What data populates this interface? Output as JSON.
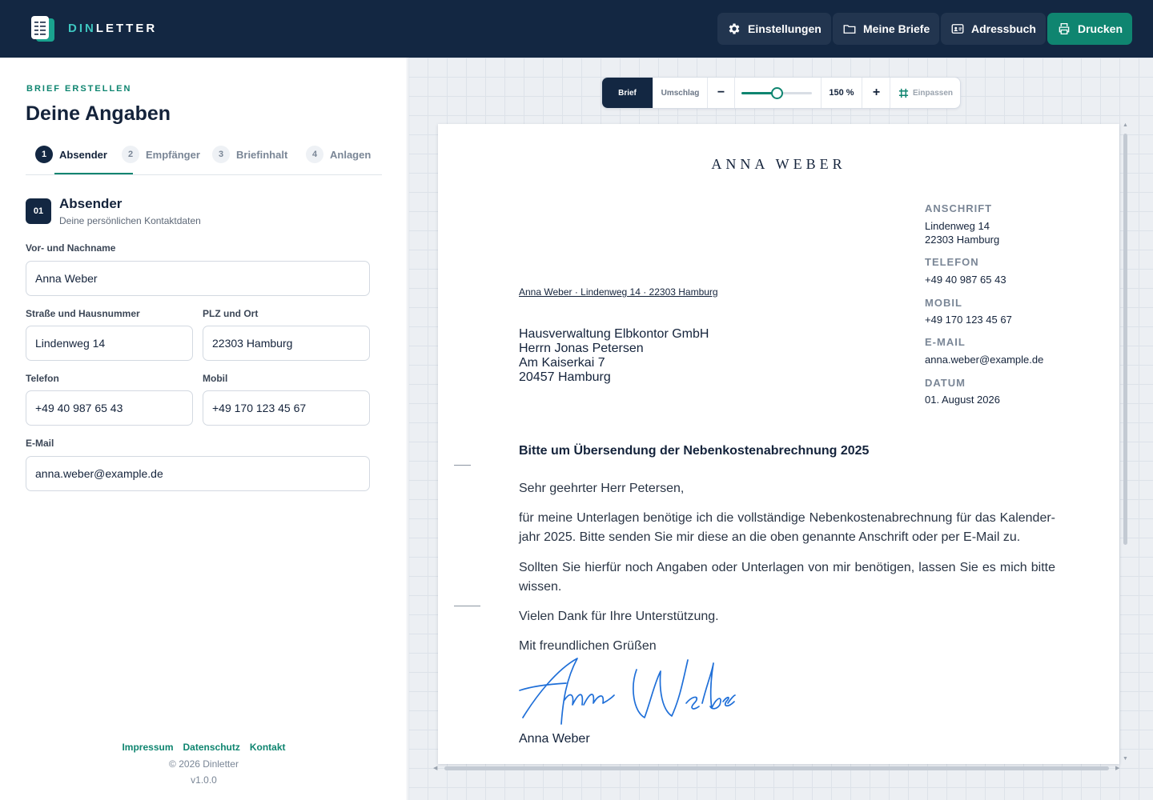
{
  "header": {
    "brand_part1": "DIN",
    "brand_part2": "LETTER",
    "nav": {
      "settings": "Einstellungen",
      "letters": "Meine Briefe",
      "addressbook": "Adressbuch",
      "print": "Drucken"
    }
  },
  "form": {
    "eyebrow": "BRIEF ERSTELLEN",
    "title": "Deine Angaben",
    "steps": [
      {
        "num": "1",
        "label": "Absender"
      },
      {
        "num": "2",
        "label": "Empfänger"
      },
      {
        "num": "3",
        "label": "Briefinhalt"
      },
      {
        "num": "4",
        "label": "Anlagen"
      }
    ],
    "section": {
      "badge": "01",
      "title": "Absender",
      "subtitle": "Deine persönlichen Kontaktdaten"
    },
    "fields": {
      "name": {
        "label": "Vor- und Nachname",
        "value": "Anna Weber"
      },
      "street": {
        "label": "Straße und Hausnummer",
        "value": "Lindenweg 14"
      },
      "city": {
        "label": "PLZ und Ort",
        "value": "22303 Hamburg"
      },
      "phone": {
        "label": "Telefon",
        "value": "+49 40 987 65 43"
      },
      "mobile": {
        "label": "Mobil",
        "value": "+49 170 123 45 67"
      },
      "email": {
        "label": "E-Mail",
        "value": "anna.weber@example.de"
      }
    }
  },
  "footer": {
    "links": [
      "Impressum",
      "Datenschutz",
      "Kontakt"
    ],
    "copyright": "© 2026 Dinletter",
    "version": "v1.0.0"
  },
  "toolbar": {
    "tab_letter": "Brief",
    "tab_envelope": "Umschlag",
    "zoom_label": "150 %",
    "zoom_fraction": 0.5,
    "fit_label": "Einpassen"
  },
  "letter": {
    "letterhead": "ANNA WEBER",
    "info": [
      {
        "label": "ANSCHRIFT",
        "lines": [
          "Lindenweg 14",
          "22303 Hamburg"
        ]
      },
      {
        "label": "TELEFON",
        "lines": [
          "+49 40 987 65 43"
        ]
      },
      {
        "label": "MOBIL",
        "lines": [
          "+49 170 123 45 67"
        ]
      },
      {
        "label": "E-MAIL",
        "lines": [
          "anna.weber@example.de"
        ]
      },
      {
        "label": "DATUM",
        "lines": [
          "01. August 2026"
        ]
      }
    ],
    "return_address": "Anna Weber · Lindenweg 14 · 22303 Hamburg",
    "recipient": [
      "Hausverwaltung Elbkontor GmbH",
      "Herrn Jonas Petersen",
      "Am Kaiserkai 7",
      "20457 Hamburg"
    ],
    "subject": "Bitte um Übersendung der Nebenkostenabrechnung 2025",
    "salutation": "Sehr geehrter Herr Petersen,",
    "paragraphs": [
      "für meine Unterlagen benötige ich die vollständige Nebenkostenabrechnung für das Kalender­jahr 2025. Bitte senden Sie mir diese an die oben genannte Anschrift oder per E-Mail zu.",
      "Sollten Sie hierfür noch Angaben oder Unterlagen von mir benötigen, lassen Sie es mich bitte wissen.",
      "Vielen Dank für Ihre Unterstützung."
    ],
    "closing": "Mit freundlichen Grüßen",
    "signer": "Anna Weber"
  },
  "colors": {
    "navy": "#132742",
    "teal": "#0f8570",
    "signature_blue": "#1f6fd8"
  }
}
